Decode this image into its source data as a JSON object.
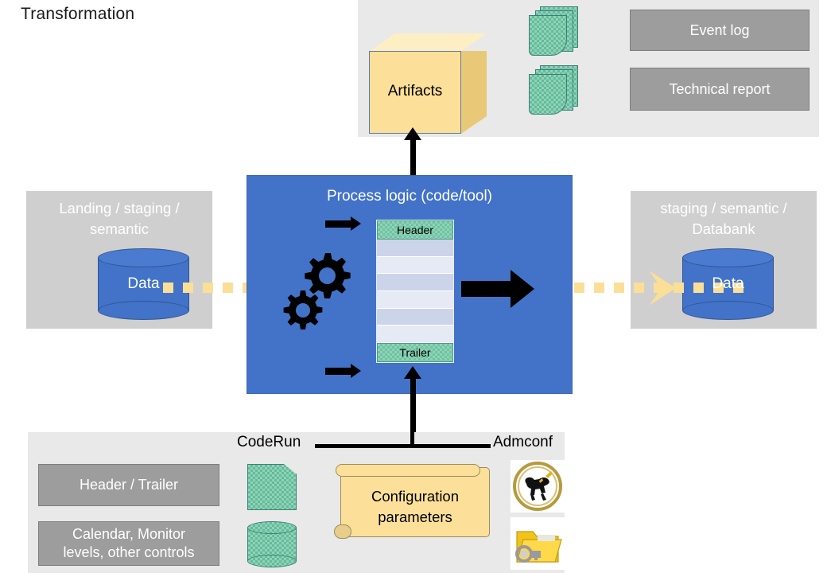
{
  "title": "Transformation",
  "source": {
    "caption": "Landing / staging /\nsemantic",
    "caption_line1": "Landing / staging /",
    "caption_line2": "semantic",
    "cylinder_label": "Data"
  },
  "target": {
    "caption_line1": "staging / semantic /",
    "caption_line2": "Databank",
    "cylinder_label": "Data"
  },
  "process": {
    "title": "Process logic (code/tool)",
    "table": {
      "header_label": "Header",
      "trailer_label": "Trailer",
      "row_count": 6
    },
    "icons": {
      "gears": "gears-icon",
      "inflow_arrow_top": "arrow-right-icon",
      "inflow_arrow_bottom": "arrow-right-icon",
      "outflow_arrow": "arrow-right-icon"
    }
  },
  "artifacts": {
    "cube_label": "Artifacts",
    "doc_stacks": [
      "document-stack-icon",
      "document-stack-icon"
    ],
    "buttons": [
      {
        "label": "Event log"
      },
      {
        "label": "Technical report"
      }
    ]
  },
  "bottom": {
    "left_label": "CodeRun",
    "right_label": "Admconf",
    "boxes": [
      {
        "label": "Header / Trailer"
      },
      {
        "label_line1": "Calendar,  Monitor",
        "label_line2": "levels, other controls"
      }
    ],
    "green_icons": [
      "document-icon",
      "database-cylinder-icon"
    ],
    "config": {
      "label_line1": "Configuration",
      "label_line2": "parameters"
    },
    "badges": [
      "kerberos-seal-icon",
      "locked-folder-icon"
    ]
  },
  "colors": {
    "process_blue": "#4273c8",
    "panel_gray": "#e9e9e9",
    "source_gray": "#cfcfcf",
    "box_gray": "#9d9d9d",
    "artifact_yellow": "#fce09a",
    "flow_yellow": "#fbdf97",
    "checker_green": "#8fd3b6"
  }
}
